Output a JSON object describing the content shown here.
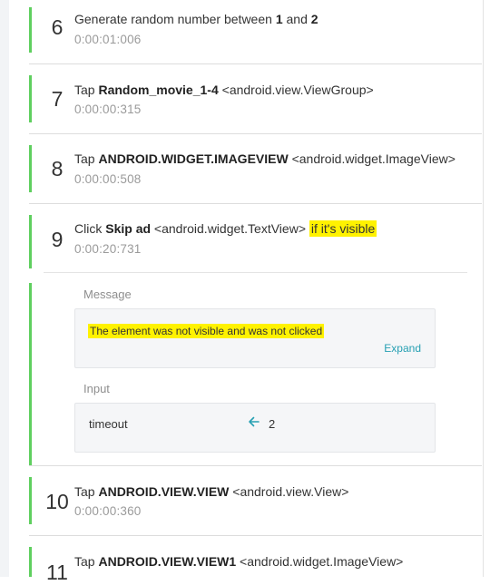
{
  "colors": {
    "accent_bar": "#5fcf5f",
    "highlight": "#fff200",
    "link": "#27a0b3"
  },
  "steps": [
    {
      "number": "6",
      "prefix": "Generate random number between ",
      "bold": "1",
      "mid": " and ",
      "bold2": "2",
      "time": "0:00:01:006"
    },
    {
      "number": "7",
      "action": "Tap",
      "target": "Random_movie_1-4",
      "element": "<android.view.ViewGroup>",
      "time": "0:00:00:315"
    },
    {
      "number": "8",
      "action": "Tap",
      "target": "ANDROID.WIDGET.IMAGEVIEW",
      "element": "<android.widget.ImageView>",
      "time": "0:00:00:508"
    },
    {
      "number": "9",
      "action": "Click",
      "target": "Skip ad",
      "element": "<android.widget.TextView>",
      "condition": "if it's visible",
      "time": "0:00:20:731"
    },
    {
      "number": "10",
      "action": "Tap",
      "target": "ANDROID.VIEW.VIEW",
      "element": "<android.view.View>",
      "time": "0:00:00:360"
    },
    {
      "number": "11",
      "action": "Tap",
      "target": "ANDROID.VIEW.VIEW1",
      "element": "<android.widget.ImageView>"
    }
  ],
  "details": {
    "message_label": "Message",
    "message_text": "The element was not visible and was not clicked",
    "expand_label": "Expand",
    "input_label": "Input",
    "input_key": "timeout",
    "input_arrow_icon": "arrow-left-icon",
    "input_value": "2"
  }
}
